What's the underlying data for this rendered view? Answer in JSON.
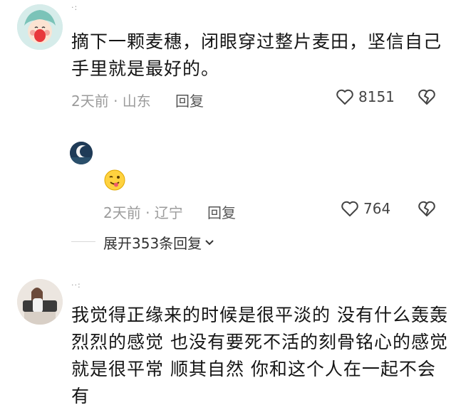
{
  "comments": [
    {
      "username": "·:",
      "text_lines": [
        "摘下一颗麦穗，闭眼穿过整片麦田，坚信自己",
        "手里就是最好的。"
      ],
      "time_location": "2天前 · 山东",
      "reply_label": "回复",
      "like_count": "8151"
    },
    {
      "username": "",
      "emoji": "😜",
      "time_location": "2天前 · 辽宁",
      "reply_label": "回复",
      "like_count": "764",
      "expand_label": "展开353条回复"
    },
    {
      "username": "··:",
      "text_lines": [
        "我觉得正缘来的时候是很平淡的 没有什么轰轰",
        "烈烈的感觉 也没有要死不活的刻骨铭心的感觉",
        "就是很平常 顺其自然 你和这个人在一起不会有"
      ]
    }
  ],
  "icons": {
    "like": "heart-outline-icon",
    "dislike": "broken-heart-icon",
    "expand": "chevron-down-icon"
  }
}
